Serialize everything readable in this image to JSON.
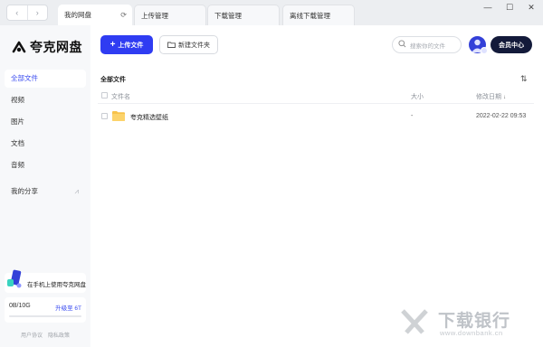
{
  "titlebar": {
    "back_label": "‹",
    "forward_label": "›",
    "refresh_label": "⟳",
    "tabs": [
      {
        "label": "我的网盘"
      },
      {
        "label": "上传管理"
      },
      {
        "label": "下载管理"
      },
      {
        "label": "离线下载管理"
      }
    ],
    "window_controls": {
      "minimize": "—",
      "maximize": "☐",
      "close": "✕"
    }
  },
  "sidebar": {
    "logo_text": "夸克网盘",
    "items": [
      {
        "label": "全部文件"
      },
      {
        "label": "视频"
      },
      {
        "label": "图片"
      },
      {
        "label": "文档"
      },
      {
        "label": "音频"
      },
      {
        "label": "我的分享"
      }
    ],
    "promo_text": "在手机上使用夸克网盘",
    "storage": {
      "used_text": "0B/10G",
      "upgrade_text": "升级至 6T",
      "used_fraction": 0.0
    },
    "footer_links": [
      "用户协议",
      "隐私政策"
    ]
  },
  "toolbar": {
    "upload_label": "上传文件",
    "new_folder_label": "新建文件夹",
    "search_placeholder": "搜索你的文件",
    "member_label": "会员中心"
  },
  "main": {
    "section_title": "全部文件",
    "columns": {
      "name": "文件名",
      "size": "大小",
      "modified": "修改日期"
    },
    "sort_indicator": "↓",
    "rows": [
      {
        "name": "夸克精选壁纸",
        "size": "-",
        "modified": "2022-02-22 09:53"
      }
    ]
  },
  "watermark": {
    "text": "下载银行",
    "url": "www.downbank.cn"
  },
  "colors": {
    "accent": "#2f3cf2",
    "dark": "#131a3a",
    "folder": "#f7c24a"
  },
  "icons": [
    "refresh-icon",
    "cloud-logo-icon",
    "share-icon",
    "plus-icon",
    "folder-outline-icon",
    "search-icon",
    "sort-icon",
    "folder-icon",
    "phone-promo-icon"
  ]
}
